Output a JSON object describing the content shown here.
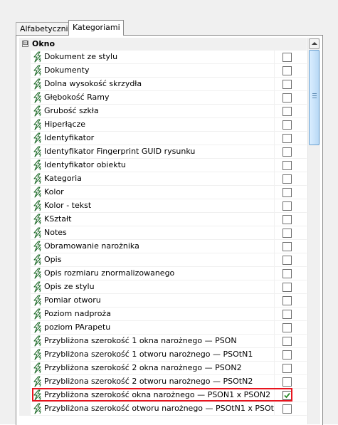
{
  "tabs": [
    {
      "label": "Alfabetycznie",
      "active": false
    },
    {
      "label": "Kategoriami",
      "active": true
    }
  ],
  "group": {
    "label": "Okno",
    "expander_symbol": "⊟"
  },
  "icon": "lightning-parameter-icon",
  "colors": {
    "highlight": "#e8141e",
    "check": "#2a8a2a"
  },
  "rows": [
    {
      "label": "Dokument ze stylu",
      "checked": false
    },
    {
      "label": "Dokumenty",
      "checked": false
    },
    {
      "label": "Dolna wysokość skrzydła",
      "checked": false
    },
    {
      "label": "Głębokość Ramy",
      "checked": false
    },
    {
      "label": "Grubość szkła",
      "checked": false
    },
    {
      "label": "Hiperłącze",
      "checked": false
    },
    {
      "label": "Identyfikator",
      "checked": false
    },
    {
      "label": "Identyfikator Fingerprint GUID rysunku",
      "checked": false
    },
    {
      "label": "Identyfikator obiektu",
      "checked": false
    },
    {
      "label": "Kategoria",
      "checked": false
    },
    {
      "label": "Kolor",
      "checked": false
    },
    {
      "label": "Kolor - tekst",
      "checked": false
    },
    {
      "label": "KSztałt",
      "checked": false
    },
    {
      "label": "Notes",
      "checked": false
    },
    {
      "label": "Obramowanie narożnika",
      "checked": false
    },
    {
      "label": "Opis",
      "checked": false
    },
    {
      "label": "Opis rozmiaru znormalizowanego",
      "checked": false
    },
    {
      "label": "Opis ze stylu",
      "checked": false
    },
    {
      "label": "Pomiar otworu",
      "checked": false
    },
    {
      "label": "Poziom nadproża",
      "checked": false
    },
    {
      "label": "poziom PArapetu",
      "checked": false
    },
    {
      "label": "Przybliżona szerokość 1 okna narożnego — PSON",
      "checked": false
    },
    {
      "label": "Przybliżona szerokość 1 otworu narożnego — PSOtN1",
      "checked": false
    },
    {
      "label": "Przybliżona szerokość 2 okna narożnego — PSON2",
      "checked": false
    },
    {
      "label": "Przybliżona szerokość 2 otworu narożnego — PSOtN2",
      "checked": false
    },
    {
      "label": "Przybliżona szerokość okna narożnego — PSON1 x PSON2",
      "checked": true,
      "highlighted": true
    },
    {
      "label": "Przybliżona szerokość otworu narożnego — PSOtN1 x PSOt...",
      "checked": false
    }
  ]
}
